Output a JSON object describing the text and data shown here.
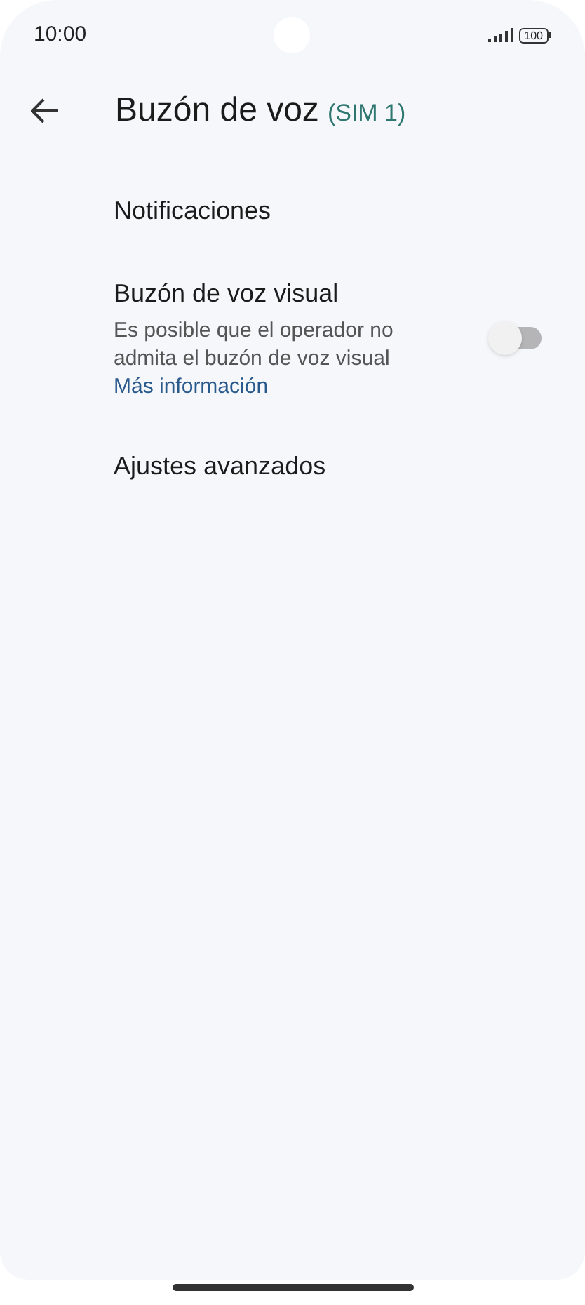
{
  "status_bar": {
    "time": "10:00",
    "battery": "100"
  },
  "header": {
    "title": "Buzón de voz",
    "subtitle": "(SIM 1)"
  },
  "items": [
    {
      "kind": "plain",
      "title": "Notificaciones"
    },
    {
      "kind": "toggle",
      "title": "Buzón de voz visual",
      "description": "Es posible que el operador no admita el buzón de voz visual",
      "link": "Más información",
      "on": false
    },
    {
      "kind": "plain",
      "title": "Ajustes avanzados"
    }
  ]
}
